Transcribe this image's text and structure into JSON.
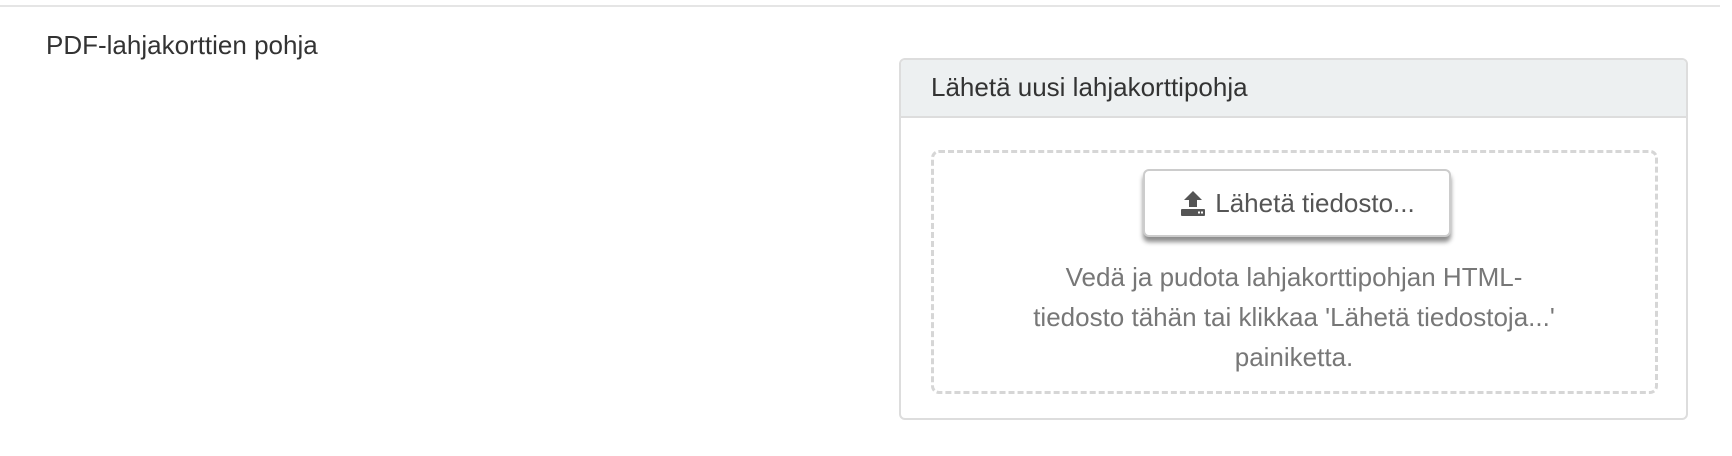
{
  "section": {
    "label": "PDF-lahjakorttien pohja"
  },
  "panel": {
    "heading": "Lähetä uusi lahjakorttipohja",
    "upload_button_label": "Lähetä tiedosto...",
    "upload_icon": "upload-icon",
    "dropzone_text": "Vedä ja pudota lahjakorttipohjan HTML-tiedosto tähän tai klikkaa 'Lähetä tiedostoja...' painiketta."
  },
  "colors": {
    "heading_bg": "#edf0f1",
    "border": "#dddddd",
    "dashed_border": "#d6d6d6",
    "text": "#333333",
    "muted_text": "#777777"
  }
}
